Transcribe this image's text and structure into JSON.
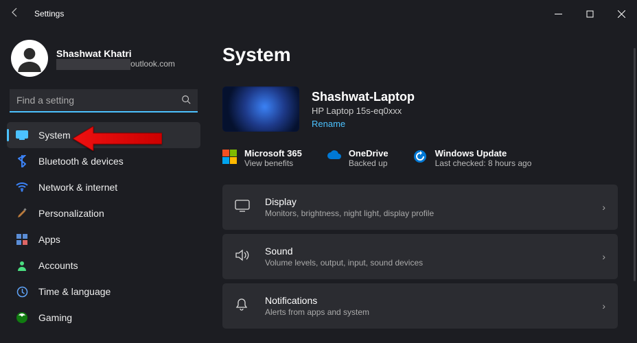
{
  "window": {
    "title": "Settings"
  },
  "profile": {
    "name": "Shashwat Khatri",
    "email_suffix": "@outlook.com"
  },
  "search": {
    "placeholder": "Find a setting"
  },
  "nav": [
    {
      "label": "System"
    },
    {
      "label": "Bluetooth & devices"
    },
    {
      "label": "Network & internet"
    },
    {
      "label": "Personalization"
    },
    {
      "label": "Apps"
    },
    {
      "label": "Accounts"
    },
    {
      "label": "Time & language"
    },
    {
      "label": "Gaming"
    }
  ],
  "page": {
    "title": "System"
  },
  "device": {
    "name": "Shashwat-Laptop",
    "model": "HP Laptop 15s-eq0xxx",
    "rename": "Rename"
  },
  "status": {
    "m365": {
      "title": "Microsoft 365",
      "sub": "View benefits"
    },
    "onedrive": {
      "title": "OneDrive",
      "sub": "Backed up"
    },
    "update": {
      "title": "Windows Update",
      "sub": "Last checked: 8 hours ago"
    }
  },
  "cards": {
    "display": {
      "title": "Display",
      "sub": "Monitors, brightness, night light, display profile"
    },
    "sound": {
      "title": "Sound",
      "sub": "Volume levels, output, input, sound devices"
    },
    "notifications": {
      "title": "Notifications",
      "sub": "Alerts from apps and system"
    }
  }
}
